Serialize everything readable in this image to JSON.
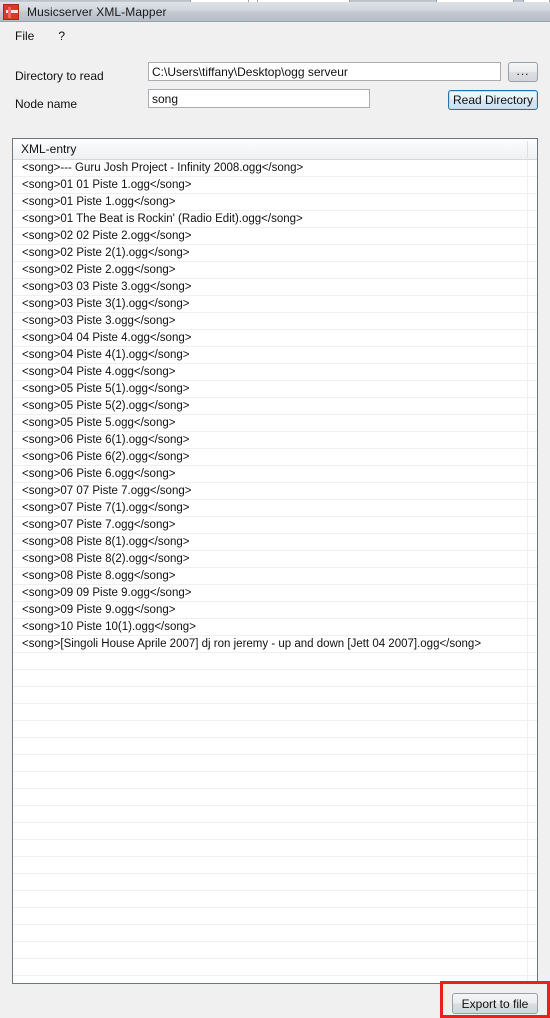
{
  "window": {
    "title": "Musicserver XML-Mapper",
    "icon": "app-icon"
  },
  "menu": {
    "items": [
      {
        "label": "File"
      },
      {
        "label": "?"
      }
    ]
  },
  "form": {
    "directory": {
      "label": "Directory to read",
      "value": "C:\\Users\\tiffany\\Desktop\\ogg serveur",
      "placeholder": ""
    },
    "node": {
      "label": "Node name",
      "value": "song",
      "placeholder": ""
    },
    "browse_button": "...",
    "read_directory_button": "Read Directory"
  },
  "list": {
    "header": "XML-entry",
    "entries": [
      "<song>--- Guru Josh Project - Infinity 2008.ogg</song>",
      "<song>01 01 Piste 1.ogg</song>",
      "<song>01 Piste 1.ogg</song>",
      "<song>01 The Beat is Rockin' (Radio Edit).ogg</song>",
      "<song>02 02 Piste 2.ogg</song>",
      "<song>02 Piste 2(1).ogg</song>",
      "<song>02 Piste 2.ogg</song>",
      "<song>03 03 Piste 3.ogg</song>",
      "<song>03 Piste 3(1).ogg</song>",
      "<song>03 Piste 3.ogg</song>",
      "<song>04 04 Piste 4.ogg</song>",
      "<song>04 Piste 4(1).ogg</song>",
      "<song>04 Piste 4.ogg</song>",
      "<song>05 Piste 5(1).ogg</song>",
      "<song>05 Piste 5(2).ogg</song>",
      "<song>05 Piste 5.ogg</song>",
      "<song>06 Piste 6(1).ogg</song>",
      "<song>06 Piste 6(2).ogg</song>",
      "<song>06 Piste 6.ogg</song>",
      "<song>07 07 Piste 7.ogg</song>",
      "<song>07 Piste 7(1).ogg</song>",
      "<song>07 Piste 7.ogg</song>",
      "<song>08 Piste 8(1).ogg</song>",
      "<song>08 Piste 8(2).ogg</song>",
      "<song>08 Piste 8.ogg</song>",
      "<song>09 09 Piste 9.ogg</song>",
      "<song>09 Piste 9.ogg</song>",
      "<song>10 Piste 10(1).ogg</song>",
      "<song>[Singoli House Aprile 2007] dj ron jeremy - up and down [Jett 04 2007].ogg</song>"
    ],
    "empty_row_count": 20
  },
  "footer": {
    "export_button": "Export to file"
  },
  "annotation": {
    "highlight_color": "#e8201e",
    "target": "export-to-file-button"
  }
}
